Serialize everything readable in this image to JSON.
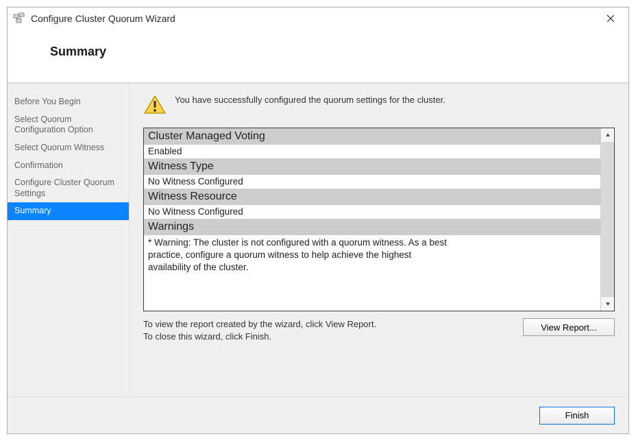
{
  "window": {
    "title": "Configure Cluster Quorum Wizard"
  },
  "header": {
    "page_title": "Summary"
  },
  "sidebar": {
    "items": [
      {
        "label": "Before You Begin",
        "active": false
      },
      {
        "label": "Select Quorum Configuration Option",
        "active": false
      },
      {
        "label": "Select Quorum Witness",
        "active": false
      },
      {
        "label": "Confirmation",
        "active": false
      },
      {
        "label": "Configure Cluster Quorum Settings",
        "active": false
      },
      {
        "label": "Summary",
        "active": true
      }
    ]
  },
  "main": {
    "message": "You have successfully configured the quorum settings for the cluster.",
    "report": {
      "sections": [
        {
          "header": "Cluster Managed Voting",
          "value": "Enabled"
        },
        {
          "header": "Witness Type",
          "value": "No Witness Configured"
        },
        {
          "header": "Witness Resource",
          "value": "No Witness Configured"
        },
        {
          "header": "Warnings",
          "value": " * Warning: The cluster is not configured with a quorum witness. As a best practice, configure a quorum witness to help achieve the highest availability of the cluster."
        }
      ]
    },
    "hint_line1": "To view the report created by the wizard, click View Report.",
    "hint_line2": "To close this wizard, click Finish.",
    "view_report_label": "View Report..."
  },
  "footer": {
    "finish_label": "Finish"
  }
}
